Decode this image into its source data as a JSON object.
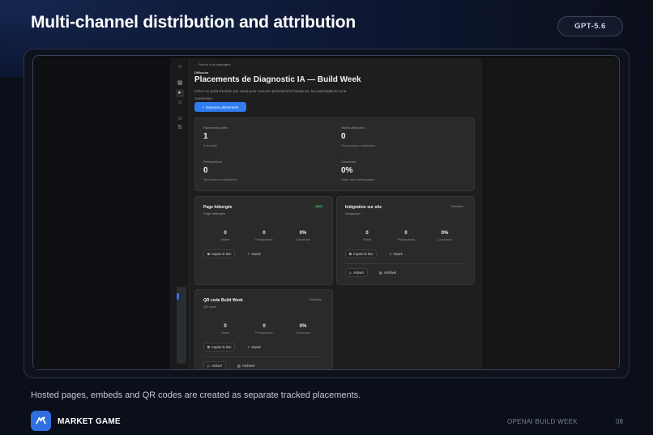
{
  "slide": {
    "title": "Multi-channel distribution and attribution",
    "model_badge": "GPT-5.6",
    "caption": "Hosted pages, embeds and QR codes are created as separate tracked placements.",
    "brand_name": "MARKET GAME",
    "footer_event": "OPENAI BUILD WEEK",
    "page_number": "08"
  },
  "app": {
    "back_link": "Retour à la campagne",
    "section_label": "Diffusion",
    "page_title": "Placements de Diagnostic IA — Build Week",
    "page_description": "Créez un point d'entrée par canal pour mesurer précisément l'audience, les participations et la conversion.",
    "new_button": "Nouveau placement",
    "stats": [
      {
        "label": "Placements actifs",
        "value": "1",
        "sub": "3 au total"
      },
      {
        "label": "Visites attribuées",
        "value": "0",
        "sub": "Tous canaux confondus"
      },
      {
        "label": "Participations",
        "value": "0",
        "sub": "Terminées et attribuées"
      },
      {
        "label": "Conversion",
        "value": "0%",
        "sub": "Visite vers participation"
      }
    ],
    "placements": [
      {
        "title": "Page hébergée",
        "subtitle": "Page hébergée",
        "status": "Actif",
        "metrics": [
          {
            "value": "0",
            "label": "Visites"
          },
          {
            "value": "0",
            "label": "Participations"
          },
          {
            "value": "0%",
            "label": "Conversion"
          }
        ],
        "copy_label": "Copier le lien",
        "open_label": "Ouvrir"
      },
      {
        "title": "Intégration sur site",
        "subtitle": "Intégration",
        "status": "Brouillon",
        "metrics": [
          {
            "value": "0",
            "label": "Visites"
          },
          {
            "value": "0",
            "label": "Participations"
          },
          {
            "value": "0%",
            "label": "Conversion"
          }
        ],
        "copy_label": "Copier le lien",
        "open_label": "Ouvrir",
        "activate_label": "Activer",
        "archive_label": "Archiver"
      },
      {
        "title": "QR code Build Week",
        "subtitle": "QR code",
        "status": "Brouillon",
        "metrics": [
          {
            "value": "0",
            "label": "Visites"
          },
          {
            "value": "0",
            "label": "Participations"
          },
          {
            "value": "0%",
            "label": "Conversion"
          }
        ],
        "copy_label": "Copier le lien",
        "open_label": "Ouvrir",
        "activate_label": "Activer",
        "archive_label": "Archiver"
      }
    ],
    "icons": {
      "back": "arrow-left-icon",
      "plus": "plus-icon",
      "copy": "copy-icon",
      "open": "external-link-icon",
      "play": "play-icon",
      "archive": "archive-icon"
    }
  }
}
